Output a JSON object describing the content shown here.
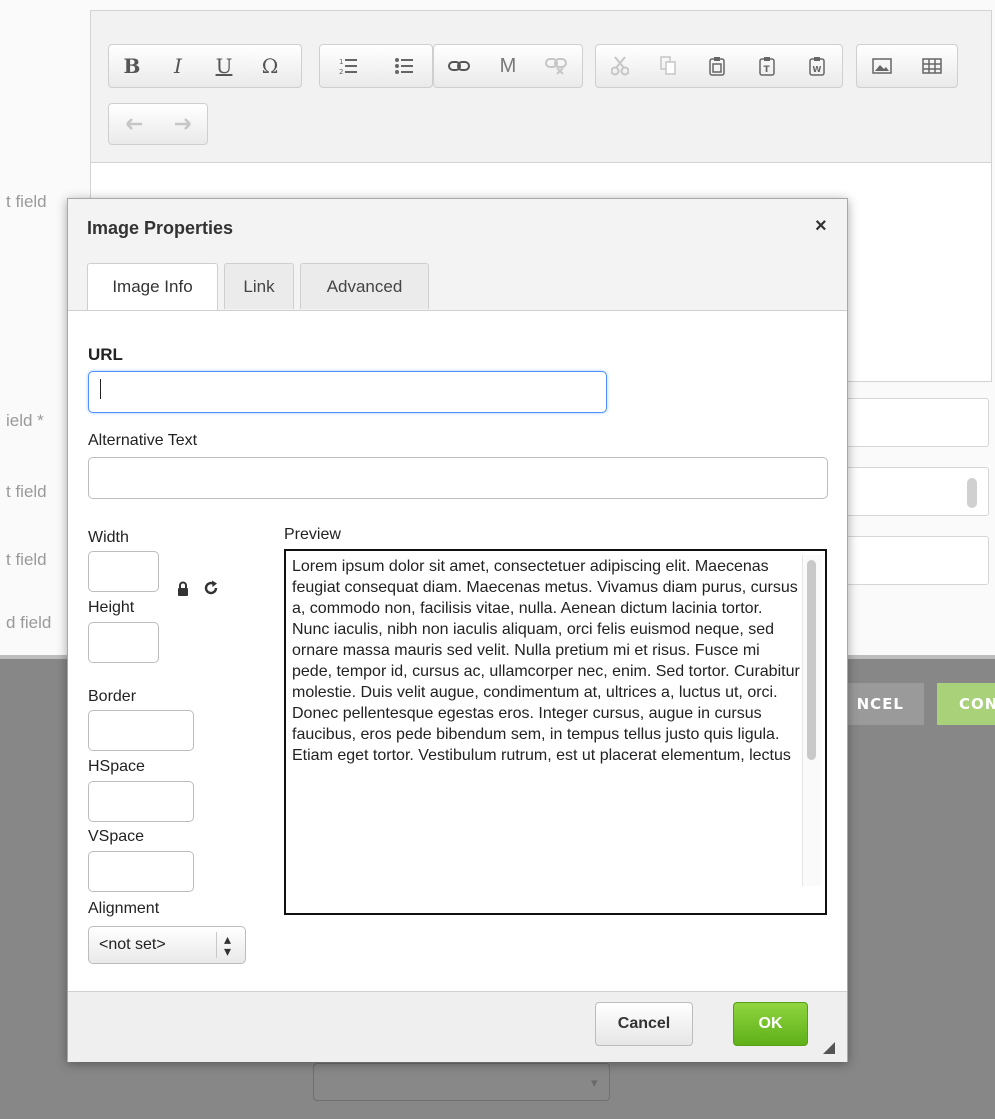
{
  "background": {
    "field_labels": [
      "t field",
      "ield *",
      "t field",
      "t field",
      "d field"
    ],
    "cancel_label": "NCEL",
    "confirm_label": "CON",
    "colors": {
      "gray": "#878787",
      "cancel_btn": "#9a9a9a",
      "confirm_btn": "#a9d17a"
    }
  },
  "toolbar": {
    "icons": [
      "bold-icon",
      "italic-icon",
      "underline-icon",
      "special-char-icon",
      "numbered-list-icon",
      "bulleted-list-icon",
      "link-icon",
      "anchor-icon",
      "unlink-icon",
      "cut-icon",
      "copy-icon",
      "paste-icon",
      "paste-text-icon",
      "paste-word-icon",
      "image-icon",
      "table-icon",
      "undo-icon",
      "redo-icon"
    ]
  },
  "dialog": {
    "title": "Image Properties",
    "close_glyph": "×",
    "tabs": [
      {
        "label": "Image Info",
        "active": true
      },
      {
        "label": "Link",
        "active": false
      },
      {
        "label": "Advanced",
        "active": false
      }
    ],
    "url_label": "URL",
    "url_value": "",
    "alt_label": "Alternative Text",
    "alt_value": "",
    "width_label": "Width",
    "height_label": "Height",
    "border_label": "Border",
    "hspace_label": "HSpace",
    "vspace_label": "VSpace",
    "alignment_label": "Alignment",
    "alignment_value": "<not set>",
    "preview_label": "Preview",
    "preview_text": "Lorem ipsum dolor sit amet, consectetuer adipiscing elit. Maecenas feugiat consequat diam. Maecenas metus. Vivamus diam purus, cursus a, commodo non, facilisis vitae, nulla. Aenean dictum lacinia tortor. Nunc iaculis, nibh non iaculis aliquam, orci felis euismod neque, sed ornare massa mauris sed velit. Nulla pretium mi et risus. Fusce mi pede, tempor id, cursus ac, ullamcorper nec, enim. Sed tortor. Curabitur molestie. Duis velit augue, condimentum at, ultrices a, luctus ut, orci. Donec pellentesque egestas eros. Integer cursus, augue in cursus faucibus, eros pede bibendum sem, in tempus tellus justo quis ligula. Etiam eget tortor. Vestibulum rutrum, est ut placerat elementum, lectus",
    "cancel_label": "Cancel",
    "ok_label": "OK",
    "ok_color": "#6cbf24"
  }
}
